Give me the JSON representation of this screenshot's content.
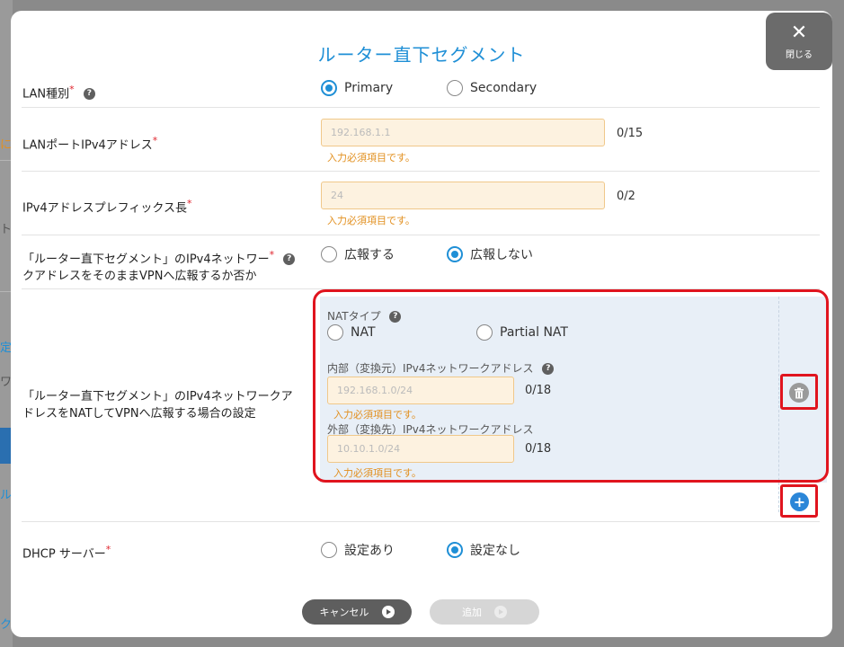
{
  "background": {
    "fragments": [
      "に",
      "ト",
      "定",
      "ワ",
      "ル",
      "ク"
    ]
  },
  "modal": {
    "title": "ルーター直下セグメント",
    "close_label": "閉じる",
    "close_icon": "close-icon"
  },
  "lan_type": {
    "label": "LAN種別",
    "required": "*",
    "options": [
      "Primary",
      "Secondary"
    ],
    "selected": "Primary"
  },
  "lan_port_ipv4": {
    "label": "LANポートIPv4アドレス",
    "required": "*",
    "placeholder": "192.168.1.1",
    "value": "",
    "counter": "0/15",
    "error": "入力必須項目です。"
  },
  "prefix_length": {
    "label": "IPv4アドレスプレフィックス長",
    "required": "*",
    "placeholder": "24",
    "value": "",
    "counter": "0/2",
    "error": "入力必須項目です。"
  },
  "advertise": {
    "label_line1": "「ルーター直下セグメント」のIPv4ネットワー",
    "label_line2": "クアドレスをそのままVPNへ広報するか否か",
    "required": "*",
    "options": [
      "広報する",
      "広報しない"
    ],
    "selected": "広報しない"
  },
  "nat": {
    "label_line1": "「ルーター直下セグメント」のIPv4ネットワークア",
    "label_line2": "ドレスをNATしてVPNへ広報する場合の設定",
    "type_label": "NATタイプ",
    "type_options": [
      "NAT",
      "Partial NAT"
    ],
    "internal_label": "内部（変換元）IPv4ネットワークアドレス",
    "internal_placeholder": "192.168.1.0/24",
    "internal_counter": "0/18",
    "internal_error": "入力必須項目です。",
    "external_label": "外部（変換先）IPv4ネットワークアドレス",
    "external_placeholder": "10.10.1.0/24",
    "external_counter": "0/18",
    "external_error": "入力必須項目です。"
  },
  "dhcp": {
    "label": "DHCP サーバー",
    "required": "*",
    "options": [
      "設定あり",
      "設定なし"
    ],
    "selected": "設定なし"
  },
  "footer": {
    "cancel_label": "キャンセル",
    "add_label": "追加"
  },
  "colors": {
    "accent": "#1f8fd6",
    "highlight": "#e0141e",
    "error": "#e29020"
  }
}
